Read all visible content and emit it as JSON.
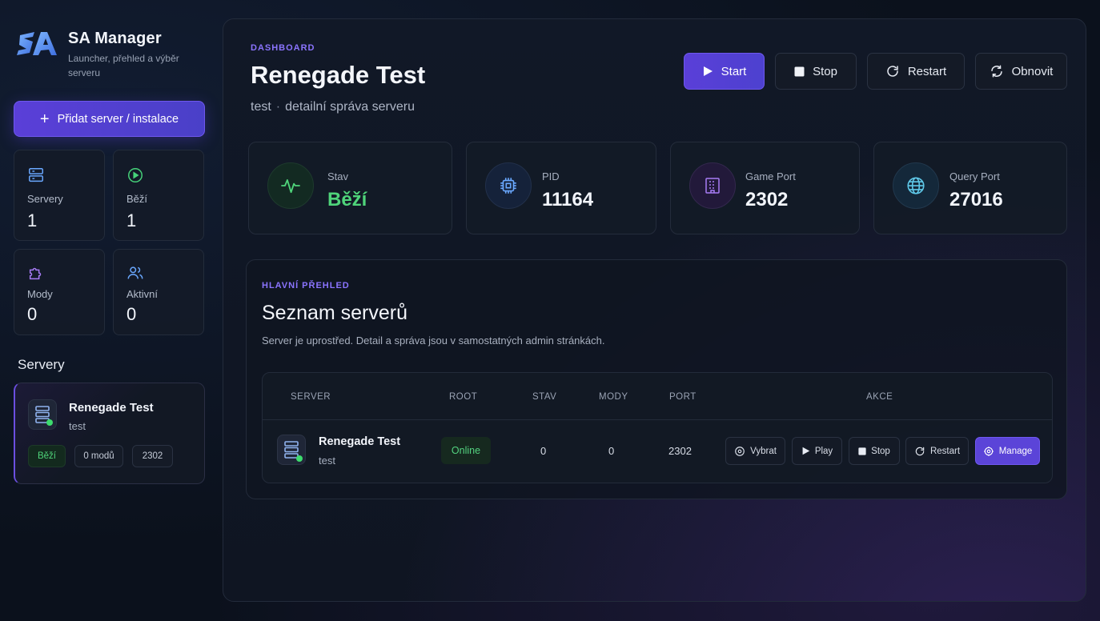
{
  "brand": {
    "logo_text": "SA",
    "title": "SA Manager",
    "subtitle": "Launcher, přehled a výběr serveru"
  },
  "sidebar": {
    "add_button": "Přidat server / instalace",
    "stats": [
      {
        "icon": "server-stack-icon",
        "label": "Servery",
        "value": "1"
      },
      {
        "icon": "play-circle-icon",
        "label": "Běží",
        "value": "1"
      },
      {
        "icon": "puzzle-icon",
        "label": "Mody",
        "value": "0"
      },
      {
        "icon": "users-icon",
        "label": "Aktivní",
        "value": "0"
      }
    ],
    "section_title": "Servery",
    "server_card": {
      "name": "Renegade Test",
      "subtitle": "test",
      "status": "Běží",
      "mods": "0 modů",
      "port": "2302"
    }
  },
  "header": {
    "eyebrow": "DASHBOARD",
    "title": "Renegade Test",
    "sub_name": "test",
    "sub_separator": "·",
    "sub_desc": "detailní správa serveru",
    "buttons": {
      "start": "Start",
      "stop": "Stop",
      "restart": "Restart",
      "refresh": "Obnovit"
    }
  },
  "metrics": [
    {
      "icon": "activity-icon",
      "label": "Stav",
      "value": "Běží",
      "color": "#4fd47a"
    },
    {
      "icon": "cpu-icon",
      "label": "PID",
      "value": "11164",
      "color": "#f2f5fb"
    },
    {
      "icon": "building-icon",
      "label": "Game Port",
      "value": "2302",
      "color": "#f2f5fb"
    },
    {
      "icon": "globe-icon",
      "label": "Query Port",
      "value": "27016",
      "color": "#f2f5fb"
    }
  ],
  "overview": {
    "eyebrow": "HLAVNÍ PŘEHLED",
    "title": "Seznam serverů",
    "description": "Server je uprostřed. Detail a správa jsou v samostatných admin stránkách.",
    "columns": [
      "SERVER",
      "ROOT",
      "STAV",
      "MODY",
      "PORT",
      "AKCE"
    ],
    "rows": [
      {
        "name": "Renegade Test",
        "subtitle": "test",
        "root": "Online",
        "stav": "0",
        "mody": "0",
        "port": "2302",
        "actions": {
          "select": "Vybrat",
          "play": "Play",
          "stop": "Stop",
          "restart": "Restart",
          "manage": "Manage"
        }
      }
    ]
  },
  "colors": {
    "accent": "#5a3fd8",
    "accent_text": "#8b74ff",
    "success": "#4fd47a",
    "background": "#0b111c"
  }
}
